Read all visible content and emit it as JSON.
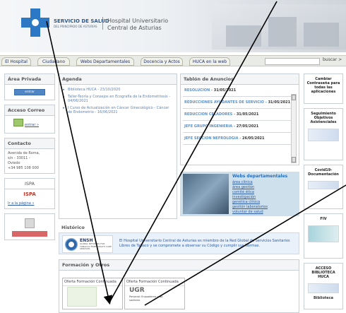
{
  "header": {
    "brand_line1": "SERVICIO DE SALUD",
    "brand_line2": "DEL PRINCIPADO DE ASTURIAS",
    "hospital_line1": "Hospital Universitario",
    "hospital_line2": "Central de Asturias"
  },
  "nav": {
    "tabs": [
      "El Hospital",
      "Ciudadano",
      "Webs Departamentales",
      "Docencia y Actos",
      "HUCA en la web"
    ],
    "search_placeholder": "",
    "search_label": "buscar >"
  },
  "left": {
    "area_privada_title": "Área Privada",
    "enter_button": "entrar",
    "correo_title": "Acceso Correo",
    "correo_enter": "entrar »",
    "contacto_title": "Contacto",
    "contacto_lines": [
      "Avenida de Roma,",
      "s/n - 33011 -",
      "Oviedo",
      "+34 985 108 000"
    ],
    "ispa_title": "ISPA",
    "ispa_logo": "ISPA",
    "ispa_link": "Ir a la página »"
  },
  "agenda": {
    "title": "Agenda",
    "items": [
      "Biblioteca HUCA - 23/10/2020",
      "Taller-Teoría y Consejos en Ecografía de la Endometriosis - 04/06/2021",
      "I Curso de Actualización en Cáncer Ginecológico - Cáncer de Endometrio - 16/06/2021"
    ]
  },
  "tablon": {
    "title": "Tablón de Anuncios",
    "items": [
      {
        "title": "RESOLUCION",
        "date": "31/05/2021"
      },
      {
        "title": "REDUCCIONES AYUDANTES DE SERVICIO",
        "date": "31/05/2021"
      },
      {
        "title": "REDUCCION CELADORES",
        "date": "31/05/2021"
      },
      {
        "title": "JEFE GRUPO INGENIERIA",
        "date": "27/05/2021"
      },
      {
        "title": "JEFE SECCION NEFROLOGIA",
        "date": "26/05/2021"
      }
    ]
  },
  "webs": {
    "title": "Webs departamentales",
    "links": [
      "área clínica",
      "área gestión",
      "comité ética",
      "investigación",
      "genética clínica",
      "gestión laboratorios",
      "voluntar de salud"
    ]
  },
  "historico": {
    "title": "Histórico",
    "ensh_name": "ENSH",
    "ensh_sub": "GLOBAL NETWORK FOR TOBACCO FREE HEALTH CARE SERVICES",
    "text": "El Hospital Universitario Central de Asturias es miembro de la Red Global de Servicios Sanitarios Libres de Tabaco y se compromete a observar su Código y cumplir sus Normas."
  },
  "formacion": {
    "title": "Formación y Otros",
    "card1_title": "Oferta Formación Continuada",
    "card2_title": "Oferta Formación Continuada",
    "card2_logo": "UGR",
    "card2_sub": "Personal: Enquaderno y No sanitario"
  },
  "right": {
    "items": [
      "Cambiar Contraseña para todas las aplicaciones",
      "Seguimiento Objetivos Asistenciales",
      "Covid19-Documentación",
      "FIV",
      "ACCESO BIBLIOTECA HUCA"
    ],
    "biblioteca_label": "Biblioteca"
  },
  "colors": {
    "accent": "#2c78c4",
    "link": "#2a5aa4",
    "tablon_link": "#5a90c8"
  }
}
